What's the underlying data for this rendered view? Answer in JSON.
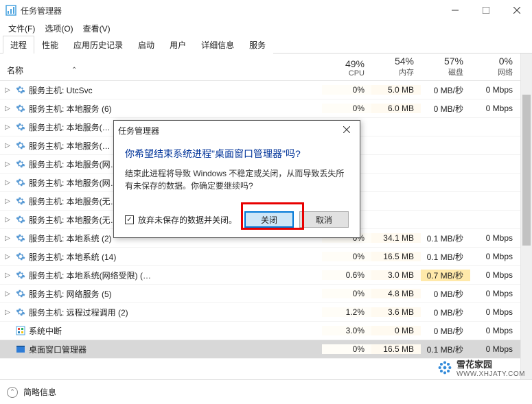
{
  "window": {
    "title": "任务管理器",
    "menus": [
      "文件(F)",
      "选项(O)",
      "查看(V)"
    ],
    "tabs": [
      "进程",
      "性能",
      "应用历史记录",
      "启动",
      "用户",
      "详细信息",
      "服务"
    ]
  },
  "columns": {
    "name": "名称",
    "cpu": {
      "pct": "49%",
      "label": "CPU"
    },
    "mem": {
      "pct": "54%",
      "label": "内存"
    },
    "disk": {
      "pct": "57%",
      "label": "磁盘"
    },
    "net": {
      "pct": "0%",
      "label": "网络"
    }
  },
  "rows": [
    {
      "name": "服务主机: UtcSvc",
      "cpu": "0%",
      "mem": "5.0 MB",
      "disk": "0 MB/秒",
      "net": "0 Mbps"
    },
    {
      "name": "服务主机: 本地服务 (6)",
      "cpu": "0%",
      "mem": "6.0 MB",
      "disk": "0 MB/秒",
      "net": "0 Mbps"
    },
    {
      "name": "服务主机: 本地服务(…",
      "cpu": "",
      "mem": "",
      "disk": "",
      "net": ""
    },
    {
      "name": "服务主机: 本地服务(…",
      "cpu": "",
      "mem": "",
      "disk": "",
      "net": ""
    },
    {
      "name": "服务主机: 本地服务(网…",
      "cpu": "",
      "mem": "",
      "disk": "",
      "net": ""
    },
    {
      "name": "服务主机: 本地服务(网…",
      "cpu": "",
      "mem": "",
      "disk": "",
      "net": ""
    },
    {
      "name": "服务主机: 本地服务(无…",
      "cpu": "",
      "mem": "",
      "disk": "",
      "net": ""
    },
    {
      "name": "服务主机: 本地服务(无…",
      "cpu": "",
      "mem": "",
      "disk": "",
      "net": ""
    },
    {
      "name": "服务主机: 本地系统 (2)",
      "cpu": "0%",
      "mem": "34.1 MB",
      "disk": "0.1 MB/秒",
      "net": "0 Mbps"
    },
    {
      "name": "服务主机: 本地系统 (14)",
      "cpu": "0%",
      "mem": "16.5 MB",
      "disk": "0.1 MB/秒",
      "net": "0 Mbps"
    },
    {
      "name": "服务主机: 本地系统(网络受限) (…",
      "cpu": "0.6%",
      "mem": "3.0 MB",
      "disk": "0.7 MB/秒",
      "net": "0 Mbps",
      "hlDisk": true
    },
    {
      "name": "服务主机: 网络服务 (5)",
      "cpu": "0%",
      "mem": "4.8 MB",
      "disk": "0 MB/秒",
      "net": "0 Mbps"
    },
    {
      "name": "服务主机: 远程过程调用 (2)",
      "cpu": "1.2%",
      "mem": "3.6 MB",
      "disk": "0 MB/秒",
      "net": "0 Mbps"
    },
    {
      "name": "系统中断",
      "cpu": "3.0%",
      "mem": "0 MB",
      "disk": "0 MB/秒",
      "net": "0 Mbps",
      "noExpand": true,
      "hlCpu": true
    },
    {
      "name": "桌面窗口管理器",
      "cpu": "0%",
      "mem": "16.5 MB",
      "disk": "0.1 MB/秒",
      "net": "0 Mbps",
      "noExpand": true,
      "selected": true
    }
  ],
  "dialog": {
    "title": "任务管理器",
    "question": "你希望结束系统进程\"桌面窗口管理器\"吗?",
    "message": "结束此进程将导致 Windows 不稳定或关闭，从而导致丢失所有未保存的数据。你确定要继续吗?",
    "checkbox": "放弃未保存的数据并关闭。",
    "primary": "关闭",
    "cancel": "取消"
  },
  "footer": {
    "label": "简略信息"
  },
  "watermark": {
    "line1": "雪花家园",
    "line2": "WWW.XHJATY.COM"
  }
}
